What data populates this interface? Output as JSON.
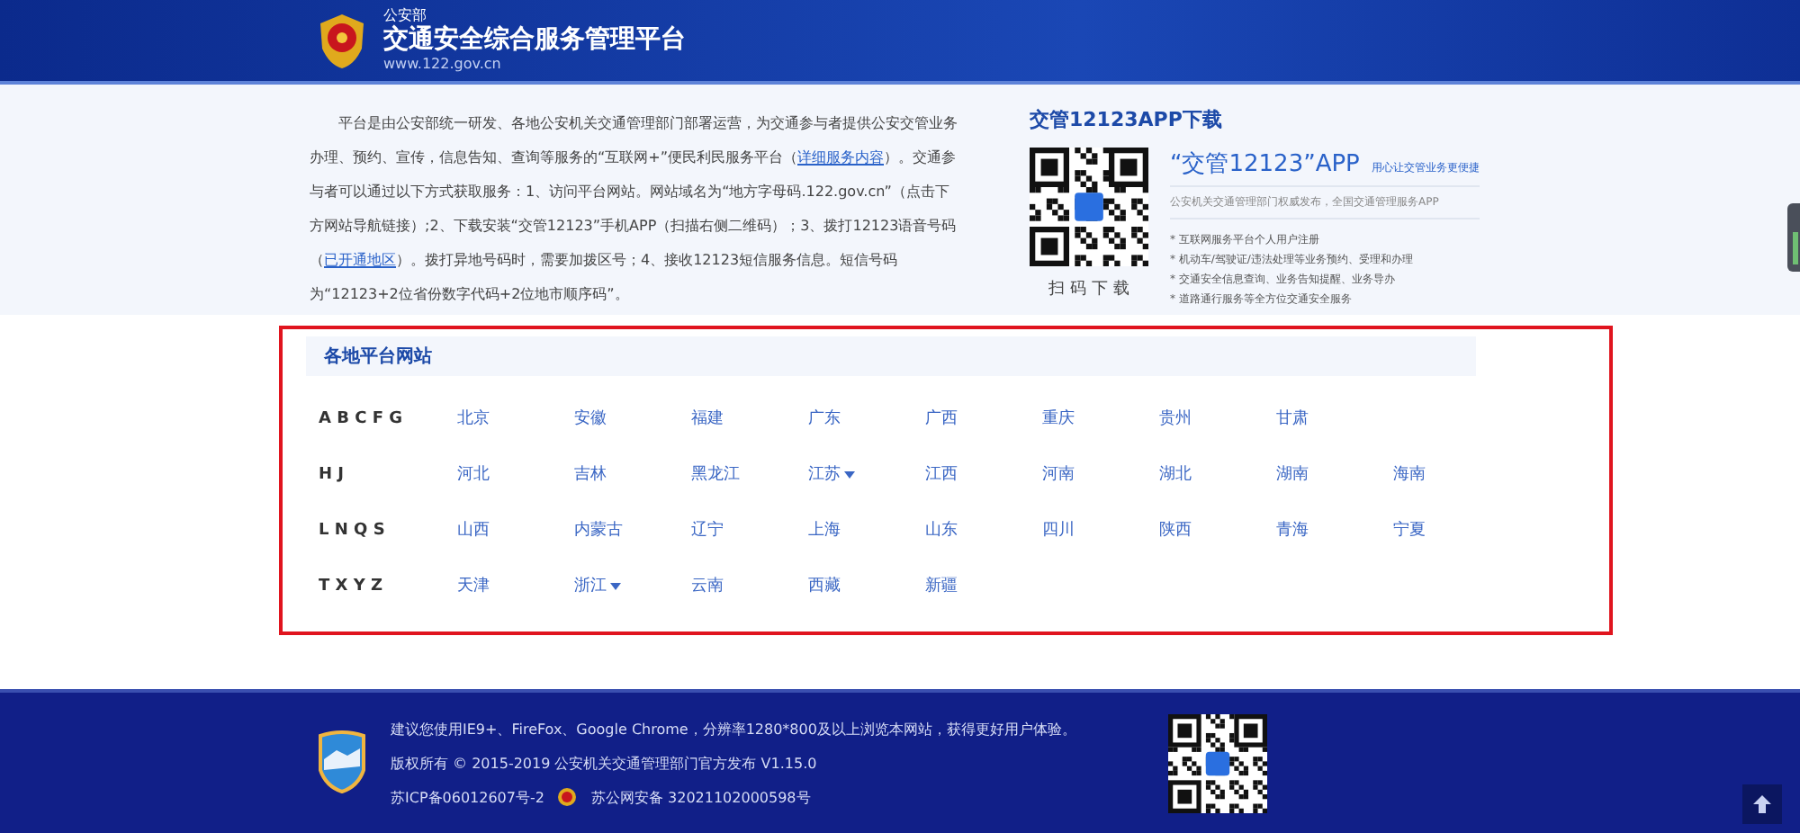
{
  "header": {
    "ministry": "公安部",
    "title": "交通安全综合服务管理平台",
    "url": "www.122.gov.cn"
  },
  "intro": {
    "parts": [
      {
        "kind": "text",
        "text": "平台是由公安部统一研发、各地公安机关交通管理部门部署运营，为交通参与者提供公安交管业务办理、预约、宣传，信息告知、查询等服务的“互联网+”便民利民服务平台（"
      },
      {
        "kind": "link",
        "text": "详细服务内容"
      },
      {
        "kind": "text",
        "text": "）。交通参与者可以通过以下方式获取服务：1、访问平台网站。网站域名为“地方字母码.122.gov.cn”（点击下方网站导航链接）;2、下载安装“交管12123”手机APP（扫描右侧二维码）；3、拨打12123语音号码（"
      },
      {
        "kind": "link",
        "text": "已开通地区"
      },
      {
        "kind": "text",
        "text": "）。拨打异地号码时，需要加拨区号；4、接收12123短信服务信息。短信号码为“12123+2位省份数字代码+2位地市顺序码”。"
      }
    ]
  },
  "app": {
    "heading": "交管12123APP下载",
    "scan_label": "扫 码 下 载",
    "name": "“交管12123”APP",
    "slogan": "用心让交管业务更便捷",
    "publisher": "公安机关交通管理部门权威发布，全国交通管理服务APP",
    "features": [
      "* 互联网服务平台个人用户注册",
      "* 机动车/驾驶证/违法处理等业务预约、受理和办理",
      "* 交通安全信息查询、业务告知提醒、业务导办",
      "* 道路通行服务等全方位交通安全服务"
    ]
  },
  "regions": {
    "heading": "各地平台网站",
    "rows": [
      {
        "letters": "A B C F G",
        "cities": [
          {
            "name": "北京",
            "kind": "link"
          },
          {
            "name": "安徽",
            "kind": "link"
          },
          {
            "name": "福建",
            "kind": "link"
          },
          {
            "name": "广东",
            "kind": "link"
          },
          {
            "name": "广西",
            "kind": "link"
          },
          {
            "name": "重庆",
            "kind": "link"
          },
          {
            "name": "贵州",
            "kind": "link"
          },
          {
            "name": "甘肃",
            "kind": "link"
          }
        ]
      },
      {
        "letters": "H J",
        "cities": [
          {
            "name": "河北",
            "kind": "link"
          },
          {
            "name": "吉林",
            "kind": "link"
          },
          {
            "name": "黑龙江",
            "kind": "link"
          },
          {
            "name": "江苏",
            "kind": "menu"
          },
          {
            "name": "江西",
            "kind": "link"
          },
          {
            "name": "河南",
            "kind": "link"
          },
          {
            "name": "湖北",
            "kind": "link"
          },
          {
            "name": "湖南",
            "kind": "link"
          },
          {
            "name": "海南",
            "kind": "link"
          }
        ]
      },
      {
        "letters": "L N Q S",
        "cities": [
          {
            "name": "山西",
            "kind": "link"
          },
          {
            "name": "内蒙古",
            "kind": "link"
          },
          {
            "name": "辽宁",
            "kind": "link"
          },
          {
            "name": "上海",
            "kind": "link"
          },
          {
            "name": "山东",
            "kind": "link"
          },
          {
            "name": "四川",
            "kind": "link"
          },
          {
            "name": "陕西",
            "kind": "link"
          },
          {
            "name": "青海",
            "kind": "link"
          },
          {
            "name": "宁夏",
            "kind": "link"
          }
        ]
      },
      {
        "letters": "T X Y Z",
        "cities": [
          {
            "name": "天津",
            "kind": "link"
          },
          {
            "name": "浙江",
            "kind": "menu"
          },
          {
            "name": "云南",
            "kind": "link"
          },
          {
            "name": "西藏",
            "kind": "link"
          },
          {
            "name": "新疆",
            "kind": "link"
          }
        ]
      }
    ]
  },
  "footer": {
    "browser_note": "建议您使用IE9+、FireFox、Google Chrome，分辨率1280*800及以上浏览本网站，获得更好用户体验。",
    "copyright": "版权所有 © 2015-2019 公安机关交通管理部门官方发布 V1.15.0",
    "icp": "苏ICP备06012607号-2",
    "police_record": "苏公网安备 32021102000598号"
  }
}
